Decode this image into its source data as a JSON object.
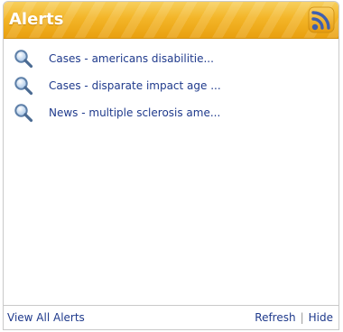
{
  "header": {
    "title": "Alerts",
    "rss_icon": "rss-feed-icon"
  },
  "alerts": [
    {
      "icon": "magnifier-icon",
      "label": "Cases - americans disabilitie..."
    },
    {
      "icon": "magnifier-icon",
      "label": "Cases - disparate impact age ..."
    },
    {
      "icon": "magnifier-icon",
      "label": "News - multiple sclerosis ame..."
    }
  ],
  "footer": {
    "view_all": "View All Alerts",
    "refresh": "Refresh",
    "separator": "|",
    "hide": "Hide"
  },
  "colors": {
    "header_gold": "#f3b528",
    "link_blue": "#1f3a8c",
    "border_gray": "#c9c9c9"
  }
}
